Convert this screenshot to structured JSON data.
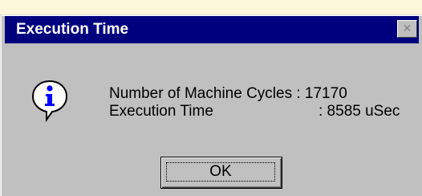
{
  "dialog": {
    "title": "Execution Time",
    "close_symbol": "×",
    "icon": "info-icon",
    "icon_letter": "i",
    "rows": [
      {
        "label": "Number of Machine Cycles : 17170"
      },
      {
        "label": "Execution Time",
        "value": ": 8585 uSec"
      }
    ],
    "ok_label": "OK"
  },
  "colors": {
    "titlebar": "#00007f",
    "face": "#c0c0c0",
    "background": "#fdf7dc",
    "icon_blue": "#0000ff"
  }
}
